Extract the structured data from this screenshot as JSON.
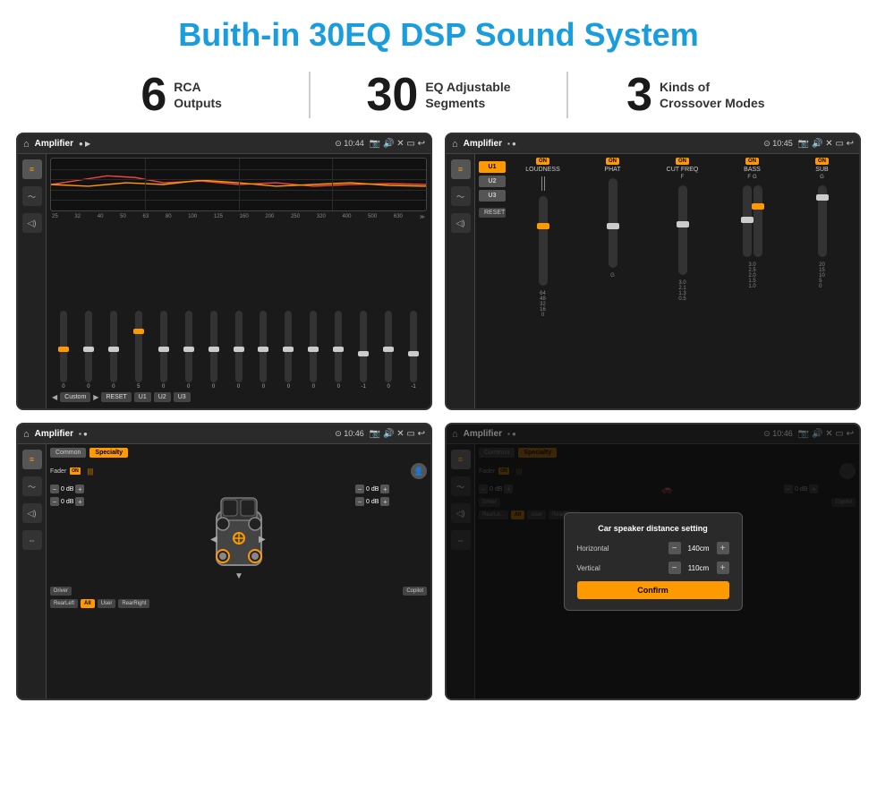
{
  "page": {
    "title": "Buith-in 30EQ DSP Sound System"
  },
  "stats": [
    {
      "number": "6",
      "label": "RCA\nOutputs"
    },
    {
      "number": "30",
      "label": "EQ Adjustable\nSegments"
    },
    {
      "number": "3",
      "label": "Kinds of\nCrossover Modes"
    }
  ],
  "screens": [
    {
      "id": "screen-eq",
      "topbar": {
        "title": "Amplifier",
        "time": "10:44"
      },
      "type": "eq"
    },
    {
      "id": "screen-amp2",
      "topbar": {
        "title": "Amplifier",
        "time": "10:45"
      },
      "type": "amp2"
    },
    {
      "id": "screen-specialty",
      "topbar": {
        "title": "Amplifier",
        "time": "10:46"
      },
      "type": "specialty"
    },
    {
      "id": "screen-dialog",
      "topbar": {
        "title": "Amplifier",
        "time": "10:46"
      },
      "type": "dialog"
    }
  ],
  "eq": {
    "frequencies": [
      "25",
      "32",
      "40",
      "50",
      "63",
      "80",
      "100",
      "125",
      "160",
      "200",
      "250",
      "320",
      "400",
      "500",
      "630"
    ],
    "values": [
      "0",
      "0",
      "0",
      "5",
      "0",
      "0",
      "0",
      "0",
      "0",
      "0",
      "0",
      "0",
      "-1",
      "0",
      "-1"
    ],
    "presets": [
      "Custom",
      "RESET",
      "U1",
      "U2",
      "U3"
    ]
  },
  "amp2": {
    "presets": [
      "U1",
      "U2",
      "U3"
    ],
    "controls": [
      "LOUDNESS",
      "PHAT",
      "CUT FREQ",
      "BASS",
      "SUB"
    ],
    "reset_label": "RESET"
  },
  "specialty": {
    "tabs": [
      "Common",
      "Specialty"
    ],
    "fader_label": "Fader",
    "on_label": "ON",
    "db_rows": [
      "0 dB",
      "0 dB",
      "0 dB",
      "0 dB"
    ],
    "bottom_btns": [
      "Driver",
      "",
      "Copilot",
      "RearLeft",
      "All",
      "User",
      "RearRight"
    ]
  },
  "dialog": {
    "title": "Car speaker distance setting",
    "horizontal_label": "Horizontal",
    "horizontal_value": "140cm",
    "vertical_label": "Vertical",
    "vertical_value": "110cm",
    "confirm_label": "Confirm"
  }
}
